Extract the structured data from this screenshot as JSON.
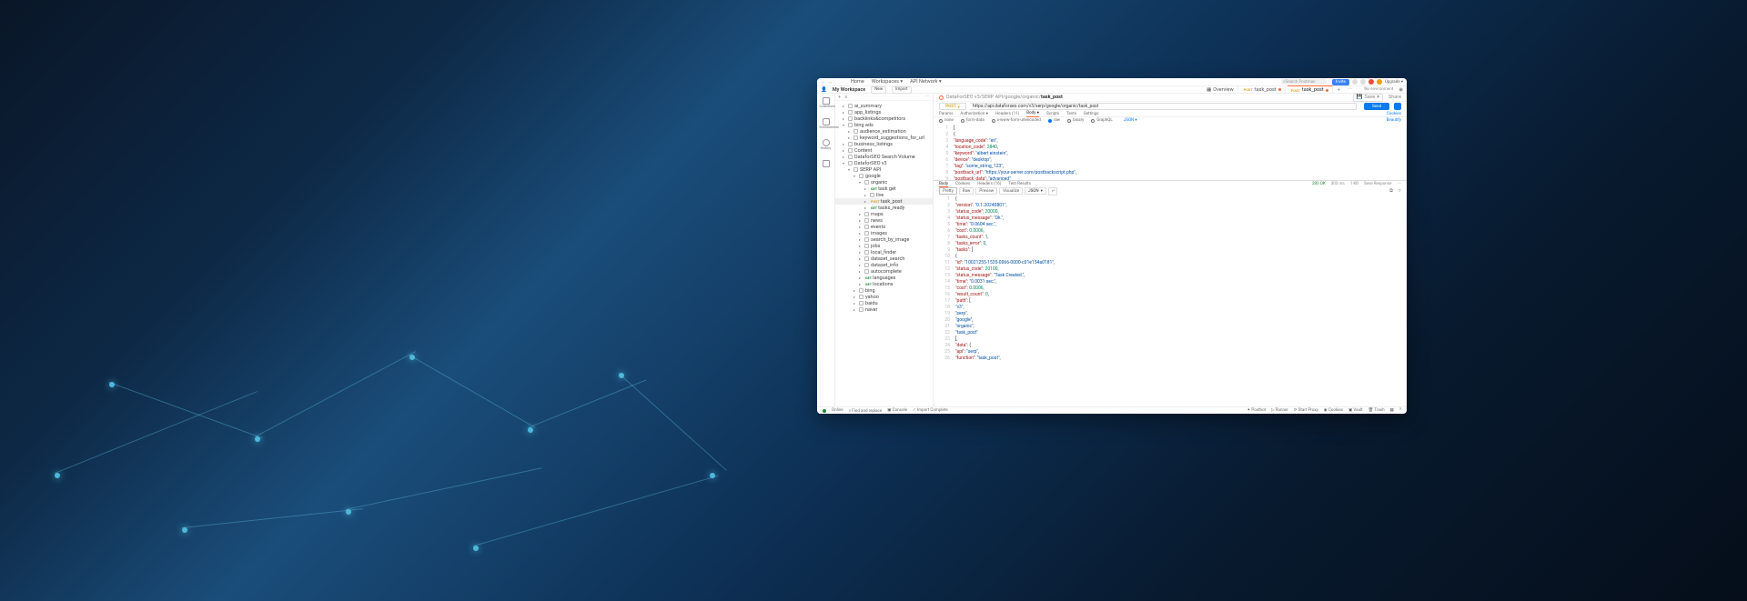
{
  "top": {
    "home": "Home",
    "workspaces": "Workspaces",
    "api_network": "API Network",
    "search_placeholder": "Search Postman",
    "invite": "Invite",
    "upgrade": "Upgrade"
  },
  "row2": {
    "workspace": "My Workspace",
    "new": "New",
    "import": "Import",
    "overview": "Overview",
    "no_env": "No environment"
  },
  "tabs": [
    {
      "method": "POST",
      "name": "task_post",
      "dirty": true,
      "active": false
    },
    {
      "method": "POST",
      "name": "task_post",
      "dirty": true,
      "active": true
    }
  ],
  "rail": {
    "collections": "Collections",
    "environments": "Environments",
    "history": "History"
  },
  "tree": {
    "items": [
      {
        "lvl": 1,
        "name": "ai_summary",
        "icon": "folder"
      },
      {
        "lvl": 1,
        "name": "app_listings",
        "icon": "folder"
      },
      {
        "lvl": 1,
        "name": "backlinks&competitors",
        "icon": "folder"
      },
      {
        "lvl": 1,
        "name": "bing ads",
        "icon": "folder",
        "caret": "▾"
      },
      {
        "lvl": 2,
        "name": "audience_estimation",
        "icon": "folder"
      },
      {
        "lvl": 2,
        "name": "keyword_suggestions_for_url",
        "icon": "folder"
      },
      {
        "lvl": 1,
        "name": "business_listings",
        "icon": "folder"
      },
      {
        "lvl": 1,
        "name": "Content",
        "icon": "folder"
      },
      {
        "lvl": 1,
        "name": "DataforSEO Search Volume",
        "icon": "folder"
      },
      {
        "lvl": 1,
        "name": "DataforSEO v3",
        "icon": "folder",
        "caret": "▾"
      },
      {
        "lvl": 2,
        "name": "SERP API",
        "icon": "folder",
        "caret": "▾"
      },
      {
        "lvl": 3,
        "name": "google",
        "icon": "folder",
        "caret": "▾"
      },
      {
        "lvl": 4,
        "name": "organic",
        "icon": "folder",
        "caret": "▾"
      },
      {
        "lvl": 5,
        "name": "task get",
        "method": "GET"
      },
      {
        "lvl": 5,
        "name": "live",
        "icon": "folder"
      },
      {
        "lvl": 5,
        "name": "task_post",
        "method": "POST",
        "active": true
      },
      {
        "lvl": 5,
        "name": "tasks_ready",
        "method": "GET"
      },
      {
        "lvl": 4,
        "name": "maps",
        "icon": "folder"
      },
      {
        "lvl": 4,
        "name": "news",
        "icon": "folder"
      },
      {
        "lvl": 4,
        "name": "events",
        "icon": "folder"
      },
      {
        "lvl": 4,
        "name": "images",
        "icon": "folder"
      },
      {
        "lvl": 4,
        "name": "search_by_image",
        "icon": "folder"
      },
      {
        "lvl": 4,
        "name": "jobs",
        "icon": "folder"
      },
      {
        "lvl": 4,
        "name": "local_finder",
        "icon": "folder"
      },
      {
        "lvl": 4,
        "name": "dataset_search",
        "icon": "folder"
      },
      {
        "lvl": 4,
        "name": "dataset_info",
        "icon": "folder"
      },
      {
        "lvl": 4,
        "name": "autocomplete",
        "icon": "folder"
      },
      {
        "lvl": 4,
        "name": "languages",
        "method": "GET"
      },
      {
        "lvl": 4,
        "name": "locations",
        "method": "GET"
      },
      {
        "lvl": 3,
        "name": "bing",
        "icon": "folder"
      },
      {
        "lvl": 3,
        "name": "yahoo",
        "icon": "folder"
      },
      {
        "lvl": 3,
        "name": "baidu",
        "icon": "folder"
      },
      {
        "lvl": 3,
        "name": "naver",
        "icon": "folder"
      }
    ]
  },
  "breadcrumb": {
    "a": "DataForSEO v3",
    "b": "SERP API",
    "c": "google",
    "d": "organic",
    "e": "task_post",
    "save": "Save",
    "share": "Share"
  },
  "request": {
    "method": "POST",
    "url": "https://api.dataforseo.com/v3/serp/google/organic/task_post",
    "send": "Send",
    "tabs": {
      "params": "Params",
      "auth": "Authorization",
      "headers": "Headers (11)",
      "body": "Body",
      "scripts": "Scripts",
      "tests": "Tests",
      "settings": "Settings"
    },
    "cookies": "Cookies",
    "body_opts": {
      "none": "none",
      "formdata": "form-data",
      "urlenc": "x-www-form-urlencoded",
      "raw": "raw",
      "binary": "binary",
      "graphql": "GraphQL",
      "json": "JSON"
    },
    "beautify": "Beautify"
  },
  "request_body_lines": [
    "[",
    "    {",
    "        \"language_code\": \"en\",",
    "        \"location_code\": 2840,",
    "        \"keyword\": \"albert einstein\",",
    "        \"device\": \"desktop\",",
    "        \"tag\": \"some_string_123\",",
    "        \"postback_url\": \"https://your-server.com/postbackscript.php\",",
    "        \"postback_data\": \"advanced\"",
    "    }",
    "]"
  ],
  "response": {
    "tabs": {
      "body": "Body",
      "cookies": "Cookies",
      "headers": "Headers (16)",
      "tests": "Test Results"
    },
    "status": "200 OK",
    "time": "303 ms",
    "size": "1 KB",
    "save_resp": "Save Response",
    "views": {
      "pretty": "Pretty",
      "raw": "Raw",
      "preview": "Preview",
      "visualize": "Visualize",
      "json": "JSON"
    }
  },
  "response_body_lines": [
    "{",
    "    \"version\": \"0.1.20240801\",",
    "    \"status_code\": 20000,",
    "    \"status_message\": \"Ok.\",",
    "    \"time\": \"0.0604 sec.\",",
    "    \"cost\": 0.0006,",
    "    \"tasks_count\": 1,",
    "    \"tasks_error\": 0,",
    "    \"tasks\": [",
    "        {",
    "            \"id\": \"10021255-1535-0066-0000-c01e154a0181\",",
    "            \"status_code\": 20100,",
    "            \"status_message\": \"Task Created.\",",
    "            \"time\": \"0.0031 sec.\",",
    "            \"cost\": 0.0006,",
    "            \"result_count\": 0,",
    "            \"path\": [",
    "                \"v3\",",
    "                \"serp\",",
    "                \"google\",",
    "                \"organic\",",
    "                \"task_post\"",
    "            ],",
    "            \"data\": {",
    "                \"api\": \"serp\",",
    "                \"function\": \"task_post\","
  ],
  "statusbar": {
    "online": "Online",
    "find_replace": "Find and replace",
    "console": "Console",
    "import_complete": "Import Complete",
    "postbot": "Postbot",
    "runner": "Runner",
    "start_proxy": "Start Proxy",
    "cookies": "Cookies",
    "vault": "Vault",
    "trash": "Trash"
  }
}
